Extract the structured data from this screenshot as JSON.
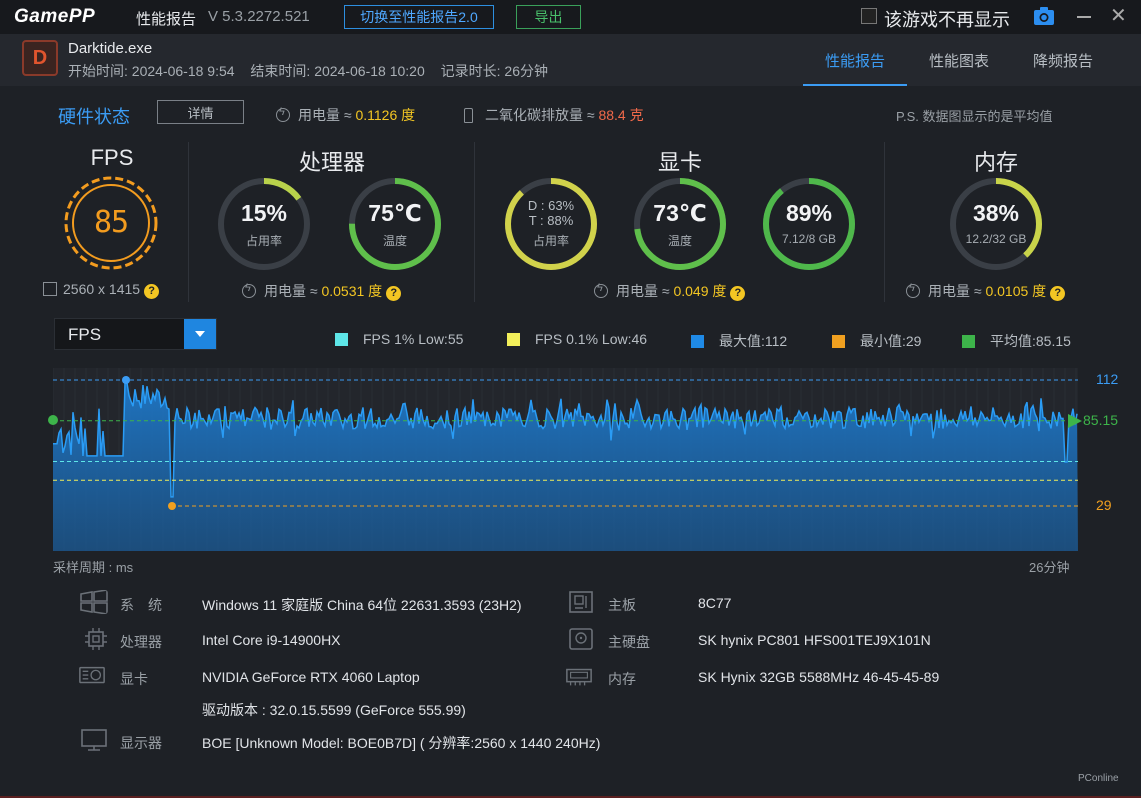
{
  "titlebar": {
    "logo_a": "Game",
    "logo_b": "PP",
    "title": "性能报告",
    "version": "V 5.3.2272.521",
    "switch_label": "切换至性能报告2.0",
    "export_label": "导出",
    "no_show_label": "该游戏不再显示",
    "close_glyph": "✕"
  },
  "app": {
    "icon_letter": "D",
    "name": "Darktide.exe",
    "start": "开始时间: 2024-06-18 9:54",
    "end": "结束时间: 2024-06-18 10:20",
    "duration": "记录时长: 26分钟"
  },
  "tabs": [
    {
      "label": "性能报告",
      "active": true
    },
    {
      "label": "性能图表",
      "active": false
    },
    {
      "label": "降频报告",
      "active": false
    }
  ],
  "hw": {
    "title": "硬件状态",
    "detail": "详情",
    "power_label": "用电量 ≈ ",
    "power_value": "0.1126 度",
    "co2_label": "二氧化碳排放量 ≈ ",
    "co2_value": "88.4 克",
    "note": "P.S. 数据图显示的是平均值"
  },
  "fps": {
    "title": "FPS",
    "value": "85",
    "resolution": "2560 x 1415",
    "q": "?"
  },
  "cpu": {
    "title": "处理器",
    "usage_value": "15%",
    "usage_label": "占用率",
    "usage_frac": 0.15,
    "temp_value": "75℃",
    "temp_label": "温度",
    "temp_frac": 0.75,
    "power_label": "用电量 ≈ ",
    "power_value": "0.0531 度",
    "q": "?"
  },
  "gpu": {
    "title": "显卡",
    "d_usage": "D : 63%",
    "t_usage": "T : 88%",
    "usage_label": "占用率",
    "usage_frac": 0.88,
    "temp_value": "73℃",
    "temp_label": "温度",
    "temp_frac": 0.73,
    "vram_value": "89%",
    "vram_label": "7.12/8 GB",
    "vram_frac": 0.89,
    "power_label": "用电量 ≈ ",
    "power_value": "0.049 度",
    "q": "?"
  },
  "mem": {
    "title": "内存",
    "value": "38%",
    "label": "12.2/32 GB",
    "frac": 0.38,
    "power_label": "用电量 ≈ ",
    "power_value": "0.0105 度",
    "q": "?"
  },
  "chart_controls": {
    "select_value": "FPS",
    "legend": [
      {
        "label": "FPS 1% Low:55",
        "color": "#5ee6e8"
      },
      {
        "label": "FPS 0.1% Low:46",
        "color": "#f2ef5a"
      },
      {
        "label": "最大值:112",
        "color": "#1f8ae6"
      },
      {
        "label": "最小值:29",
        "color": "#f0a020"
      },
      {
        "label": "平均值:85.15",
        "color": "#3db44a"
      }
    ]
  },
  "chart_data": {
    "type": "area",
    "ylabels": {
      "max": "112",
      "avg": "85.15",
      "min": "29"
    },
    "max": 112,
    "avg": 85.15,
    "min": 29,
    "low1": 55,
    "low01": 46,
    "x_caption_left": "采样周期 : ms",
    "x_caption_right": "26分钟"
  },
  "specs": {
    "os_label": "系　统",
    "os_value": "Windows 11 家庭版 China 64位 22631.3593 (23H2)",
    "cpu_label": "处理器",
    "cpu_value": "Intel Core i9-14900HX",
    "gpu_label": "显卡",
    "gpu_value": "NVIDIA GeForce RTX 4060 Laptop",
    "driver_value": "驱动版本 : 32.0.15.5599 (GeForce 555.99)",
    "display_label": "显示器",
    "display_value": "BOE [Unknown Model: BOE0B7D] ( 分辨率:2560 x 1440 240Hz)",
    "mb_label": "主板",
    "mb_value": "8C77",
    "disk_label": "主硬盘",
    "disk_value": "SK hynix PC801 HFS001TEJ9X101N",
    "ram_label": "内存",
    "ram_value": "SK Hynix 32GB 5588MHz 46-45-45-89"
  },
  "watermark": "PConline"
}
